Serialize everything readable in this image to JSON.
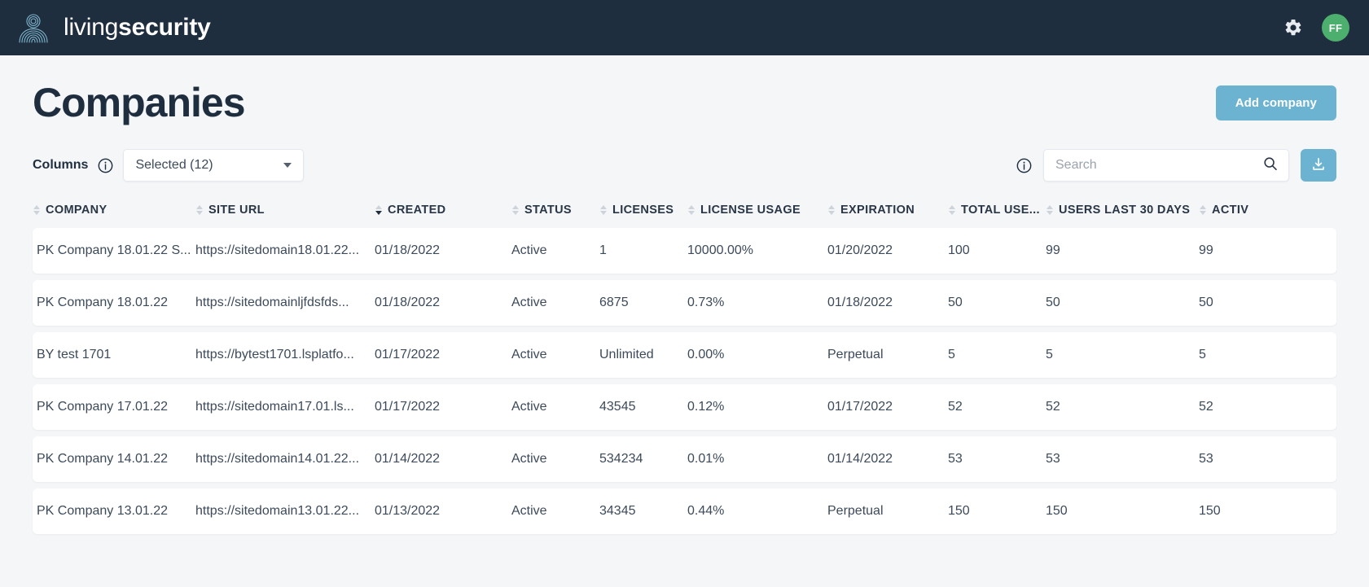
{
  "topbar": {
    "brand_light": "living",
    "brand_bold": "security",
    "brand_logo_name": "living-security-fingerprint-logo",
    "settings_icon": "gear-icon",
    "avatar_initials": "FF",
    "avatar_color": "#4caf6e",
    "background_color": "#1f2e3f"
  },
  "page": {
    "title": "Companies",
    "add_button": "Add company",
    "accent_color": "#6cb2d1"
  },
  "toolbar": {
    "columns_label": "Columns",
    "columns_info_icon": "info-icon",
    "columns_select_value": "Selected (12)",
    "caret_icon": "chevron-down-icon",
    "search_info_icon": "info-icon",
    "search_value": "",
    "search_placeholder": "Search",
    "search_icon": "search-icon",
    "download_icon": "download-icon"
  },
  "table": {
    "columns": [
      {
        "label": "COMPANY",
        "sort": "none"
      },
      {
        "label": "SITE URL",
        "sort": "none"
      },
      {
        "label": "CREATED",
        "sort": "desc"
      },
      {
        "label": "STATUS",
        "sort": "none"
      },
      {
        "label": "LICENSES",
        "sort": "none"
      },
      {
        "label": "LICENSE USAGE",
        "sort": "none"
      },
      {
        "label": "EXPIRATION",
        "sort": "none"
      },
      {
        "label": "TOTAL USE...",
        "sort": "none"
      },
      {
        "label": "USERS LAST 30 DAYS",
        "sort": "none"
      },
      {
        "label": "ACTIV",
        "sort": "none"
      }
    ],
    "rows": [
      {
        "company": "PK Company 18.01.22 S...",
        "site_url": "https://sitedomain18.01.22...",
        "created": "01/18/2022",
        "status": "Active",
        "licenses": "1",
        "license_usage": "10000.00%",
        "expiration": "01/20/2022",
        "total_users": "100",
        "users_last_30_days": "99",
        "active": "99"
      },
      {
        "company": "PK Company 18.01.22",
        "site_url": "https://sitedomainljfdsfds...",
        "created": "01/18/2022",
        "status": "Active",
        "licenses": "6875",
        "license_usage": "0.73%",
        "expiration": "01/18/2022",
        "total_users": "50",
        "users_last_30_days": "50",
        "active": "50"
      },
      {
        "company": "BY test 1701",
        "site_url": "https://bytest1701.lsplatfo...",
        "created": "01/17/2022",
        "status": "Active",
        "licenses": "Unlimited",
        "license_usage": "0.00%",
        "expiration": "Perpetual",
        "total_users": "5",
        "users_last_30_days": "5",
        "active": "5"
      },
      {
        "company": "PK Company 17.01.22",
        "site_url": "https://sitedomain17.01.ls...",
        "created": "01/17/2022",
        "status": "Active",
        "licenses": "43545",
        "license_usage": "0.12%",
        "expiration": "01/17/2022",
        "total_users": "52",
        "users_last_30_days": "52",
        "active": "52"
      },
      {
        "company": "PK Company 14.01.22",
        "site_url": "https://sitedomain14.01.22...",
        "created": "01/14/2022",
        "status": "Active",
        "licenses": "534234",
        "license_usage": "0.01%",
        "expiration": "01/14/2022",
        "total_users": "53",
        "users_last_30_days": "53",
        "active": "53"
      },
      {
        "company": "PK Company 13.01.22",
        "site_url": "https://sitedomain13.01.22...",
        "created": "01/13/2022",
        "status": "Active",
        "licenses": "34345",
        "license_usage": "0.44%",
        "expiration": "Perpetual",
        "total_users": "150",
        "users_last_30_days": "150",
        "active": "150"
      }
    ]
  }
}
